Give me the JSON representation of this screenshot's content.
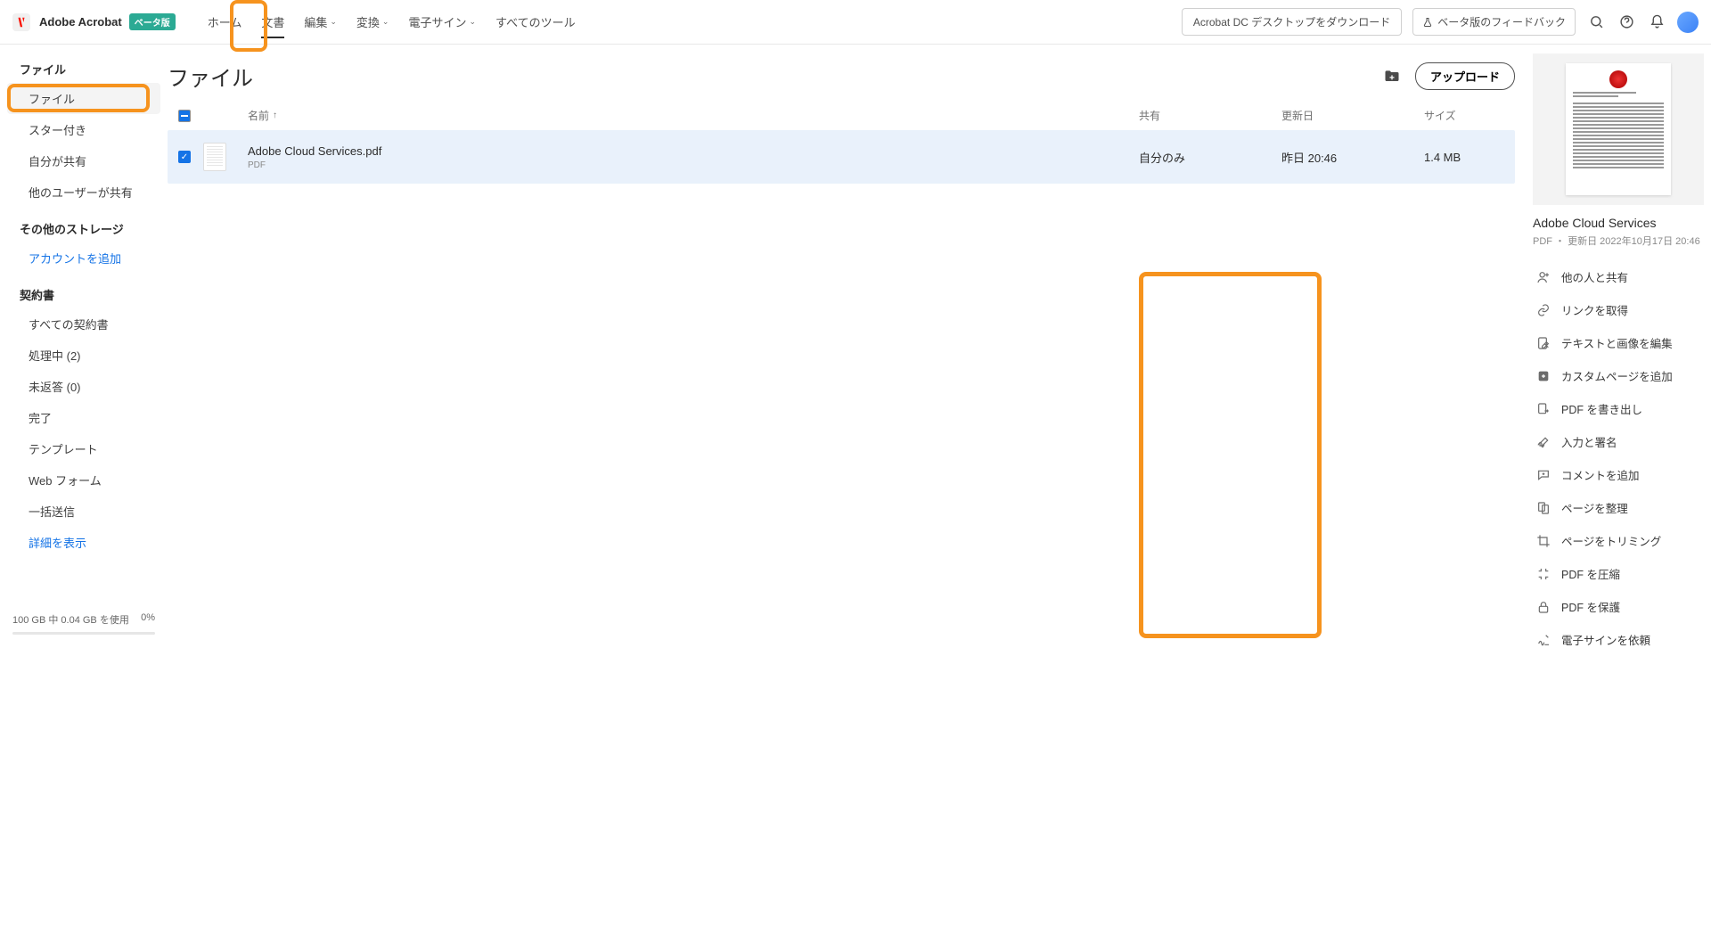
{
  "header": {
    "app_name": "Adobe Acrobat",
    "beta": "ベータ版",
    "tabs": [
      "ホーム",
      "文書",
      "編集",
      "変換",
      "電子サイン",
      "すべてのツール"
    ],
    "download": "Acrobat DC デスクトップをダウンロード",
    "feedback": "ベータ版のフィードバック"
  },
  "sidebar": {
    "s1_title": "ファイル",
    "s1_items": [
      "ファイル",
      "スター付き",
      "自分が共有",
      "他のユーザーが共有"
    ],
    "s2_title": "その他のストレージ",
    "s2_items": [
      "アカウントを追加"
    ],
    "s3_title": "契約書",
    "s3_items": [
      "すべての契約書",
      "処理中 (2)",
      "未返答 (0)",
      "完了",
      "テンプレート",
      "Web フォーム",
      "一括送信",
      "詳細を表示"
    ]
  },
  "storage": {
    "text": "100 GB 中 0.04 GB を使用",
    "pct": "0%"
  },
  "main": {
    "title": "ファイル",
    "upload": "アップロード",
    "cols": {
      "name": "名前",
      "share": "共有",
      "date": "更新日",
      "size": "サイズ"
    },
    "row": {
      "name": "Adobe Cloud Services.pdf",
      "type": "PDF",
      "share": "自分のみ",
      "date": "昨日 20:46",
      "size": "1.4 MB"
    }
  },
  "details": {
    "title": "Adobe Cloud Services",
    "meta": "PDF  ・  更新日  2022年10月17日 20:46",
    "actions": [
      "他の人と共有",
      "リンクを取得",
      "テキストと画像を編集",
      "カスタムページを追加",
      "PDF を書き出し",
      "入力と署名",
      "コメントを追加",
      "ページを整理",
      "ページをトリミング",
      "PDF を圧縮",
      "PDF を保護",
      "電子サインを依頼"
    ]
  }
}
